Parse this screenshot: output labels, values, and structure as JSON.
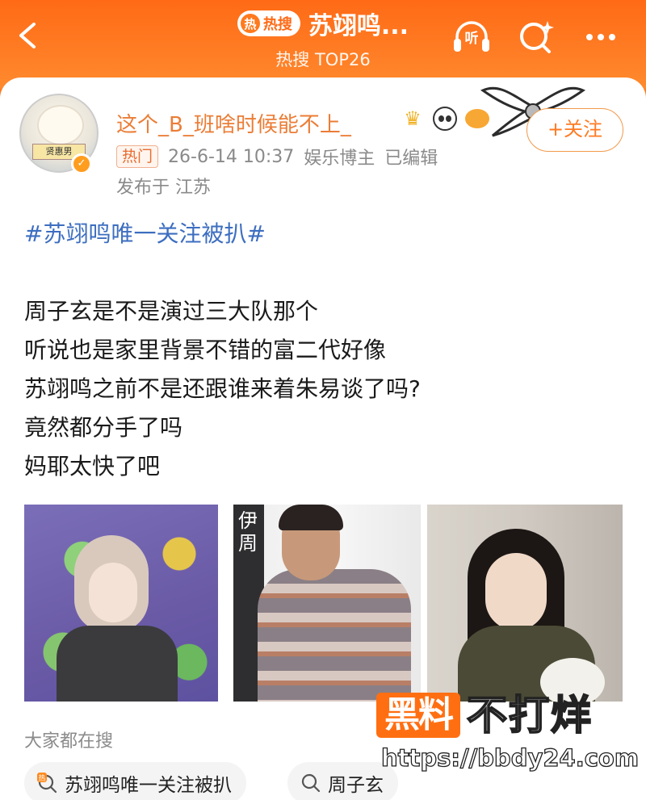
{
  "header": {
    "hot_badge_icon": "热",
    "hot_badge_text": "热搜",
    "title": "苏翊鸣...",
    "subtitle": "热搜 TOP26",
    "listen_label": "听",
    "accent_color": "#ff7a20"
  },
  "post": {
    "username": "这个_B_班啥时候能不上_",
    "follow_label": "+关注",
    "hot_tag": "热门",
    "timestamp": "26-6-14 10:37",
    "author_type": "娱乐博主",
    "edited": "已编辑",
    "location": "发布于 江苏",
    "avatar_sign": "贤惠男",
    "topic": "#苏翊鸣唯一关注被扒#",
    "lines": [
      "周子玄是不是演过三大队那个",
      "听说也是家里背景不错的富二代好像",
      "苏翊鸣之前不是还跟谁来着朱易谈了吗?",
      "竟然都分手了吗",
      "妈耶太快了吧"
    ],
    "photo2_cover_title": "伊周"
  },
  "search": {
    "label": "大家都在搜",
    "chips": [
      {
        "icon": "hot-search-icon",
        "text": "苏翊鸣唯一关注被扒"
      },
      {
        "icon": "search-icon",
        "text": "周子玄"
      }
    ]
  },
  "watermark": {
    "box_text": "黑料",
    "text": "不打烊",
    "url": "https://bbdy24.com"
  }
}
